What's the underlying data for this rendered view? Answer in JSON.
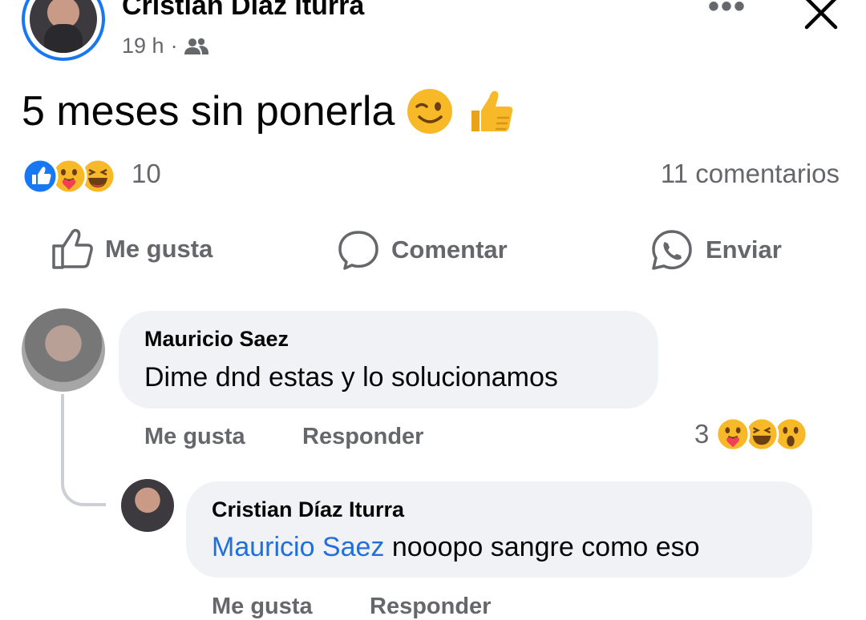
{
  "post": {
    "author": "Cristian Díaz Iturra",
    "time": "19 h",
    "separator": "·",
    "privacy_icon": "friends-icon",
    "text": "5 meses sin ponerla",
    "emojis": [
      "winking-face",
      "thumbs-up"
    ],
    "reactions": [
      "like",
      "care",
      "haha"
    ],
    "reaction_count": "10",
    "comments_count": "11 comentarios"
  },
  "actions": {
    "like": "Me gusta",
    "comment": "Comentar",
    "send": "Enviar"
  },
  "comments": [
    {
      "author": "Mauricio Saez",
      "text": "Dime dnd estas y lo solucionamos",
      "like_label": "Me gusta",
      "reply_label": "Responder",
      "reaction_count": "3",
      "reactions": [
        "care",
        "haha",
        "wow"
      ]
    },
    {
      "author": "Cristian Díaz Iturra",
      "mention": "Mauricio Saez",
      "text": " nooopo sangre como eso",
      "like_label": "Me gusta",
      "reply_label": "Responder"
    }
  ],
  "colors": {
    "accent": "#1877f2",
    "mention": "#216fdb",
    "secondary_text": "#65676b",
    "bubble": "#f0f2f5",
    "emoji_yellow": "#f7b928"
  }
}
